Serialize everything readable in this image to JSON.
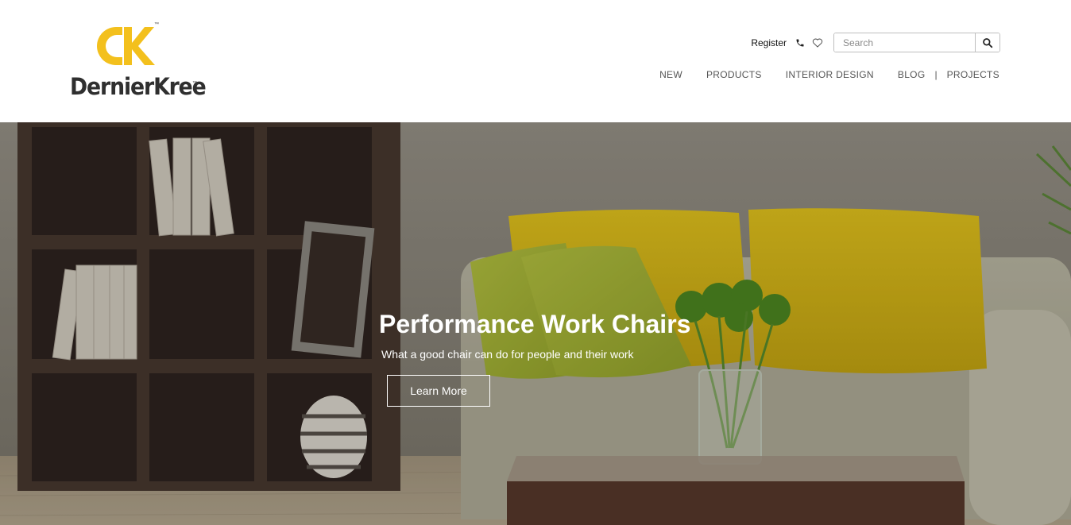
{
  "brand": {
    "name": "DernierKree",
    "monogram": "DK",
    "accent_color": "#f3c01d"
  },
  "utility": {
    "register_label": "Register",
    "phone_icon": "phone-icon",
    "wishlist_icon": "heart-icon",
    "search_placeholder": "Search",
    "search_icon": "search-icon"
  },
  "nav": {
    "items": [
      {
        "label": "NEW"
      },
      {
        "label": "PRODUCTS"
      },
      {
        "label": "INTERIOR DESIGN"
      },
      {
        "label": "BLOG"
      },
      {
        "label": "PROJECTS"
      }
    ],
    "separator": "|"
  },
  "hero": {
    "title": "Performance Work Chairs",
    "subtitle": "What a good chair can do for people and their work",
    "cta_label": "Learn More"
  }
}
